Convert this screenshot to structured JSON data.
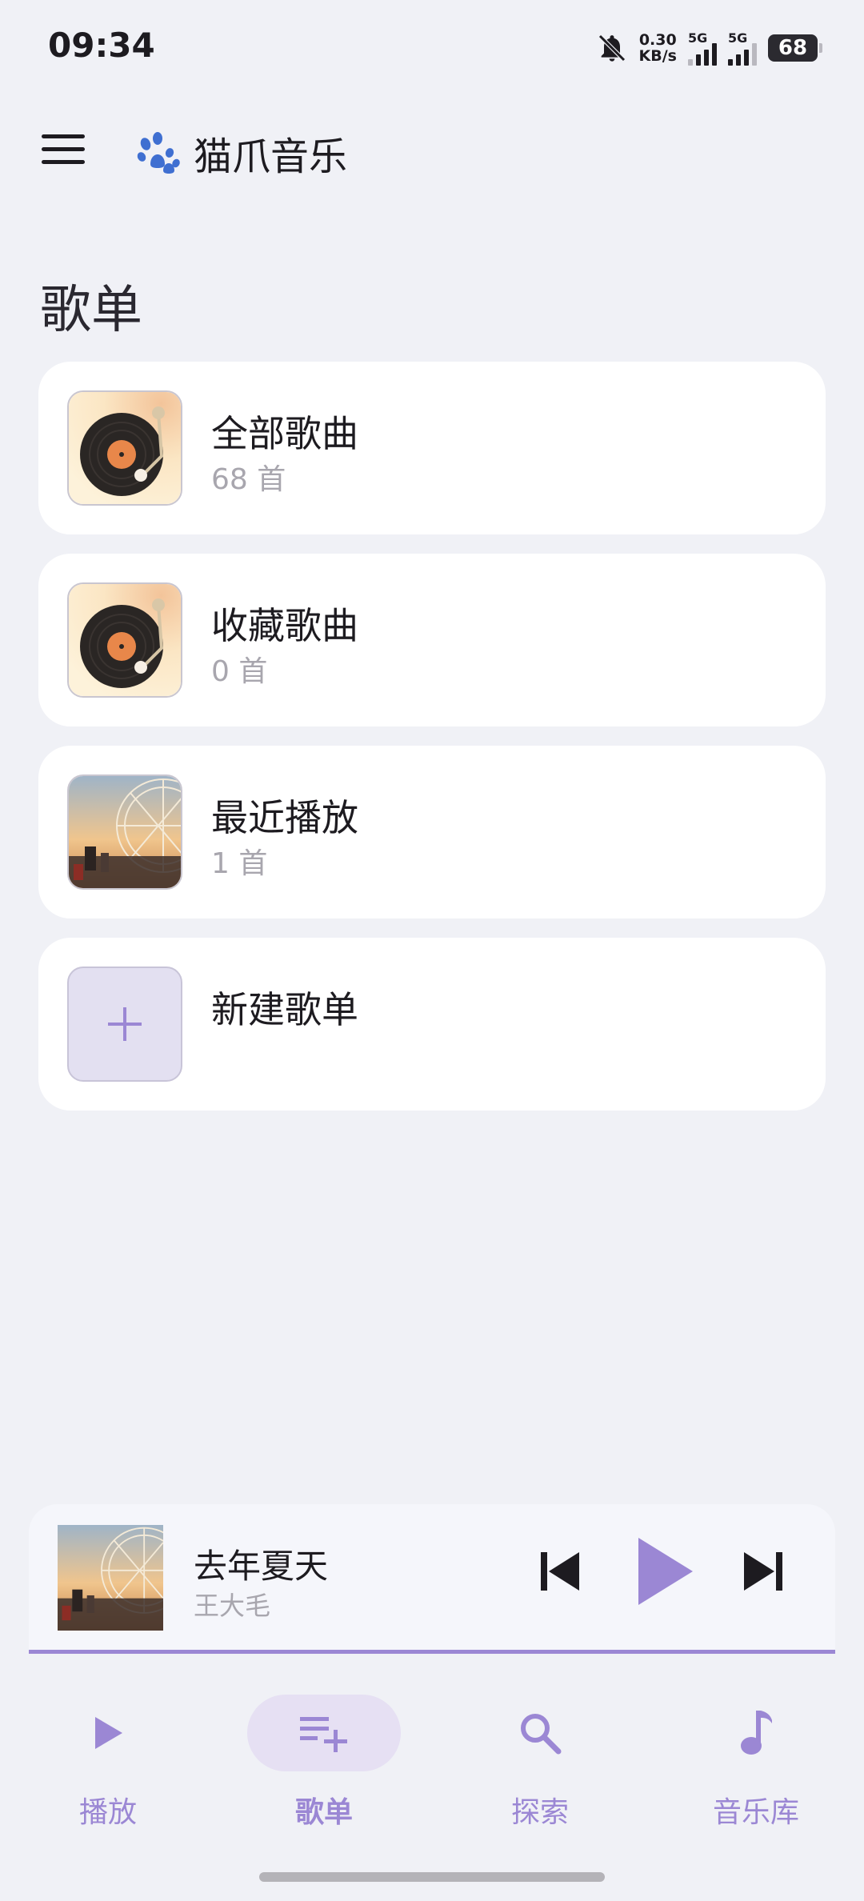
{
  "status_bar": {
    "time": "09:34",
    "net_speed_value": "0.30",
    "net_speed_unit": "KB/s",
    "signal1_label": "5G",
    "signal2_label": "5G",
    "battery": "68",
    "icons": [
      "bell-off-icon",
      "signal-icon",
      "battery-icon"
    ]
  },
  "app_bar": {
    "title": "猫爪音乐",
    "menu_icon": "menu-icon",
    "logo_icon": "paw-icon",
    "logo_color": "#3f6fd1"
  },
  "section_title": "歌单",
  "playlists": [
    {
      "title": "全部歌曲",
      "count": "68 首",
      "cover": "vinyl-record"
    },
    {
      "title": "收藏歌曲",
      "count": "0 首",
      "cover": "vinyl-record"
    },
    {
      "title": "最近播放",
      "count": "1 首",
      "cover": "ferris-wheel"
    },
    {
      "title": "新建歌单",
      "count": "",
      "cover": "plus-icon"
    }
  ],
  "mini_player": {
    "title": "去年夏天",
    "artist": "王大毛",
    "accent": "#9b87d4"
  },
  "bottom_nav": {
    "items": [
      {
        "label": "播放",
        "icon": "play-icon",
        "active": false
      },
      {
        "label": "歌单",
        "icon": "playlist-add-icon",
        "active": true
      },
      {
        "label": "探索",
        "icon": "search-icon",
        "active": false
      },
      {
        "label": "音乐库",
        "icon": "music-note-icon",
        "active": false
      }
    ],
    "accent": "#9b87d4",
    "active_bg": "#e6e0f3"
  }
}
